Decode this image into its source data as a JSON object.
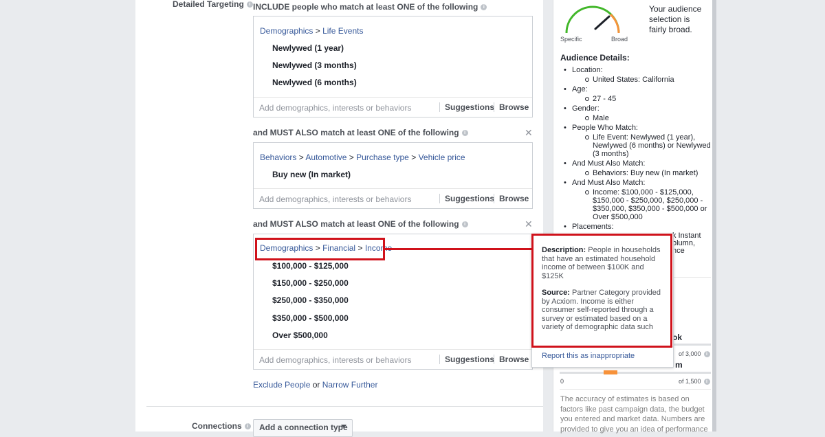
{
  "colors": {
    "accent": "#365899",
    "highlight": "#d0121b",
    "gauge_green": "#42b72a",
    "gauge_orange": "#f7923a",
    "bar_orange": "#f7923a"
  },
  "targeting": {
    "label": "Detailed Targeting",
    "include_text": "INCLUDE people who match at least ONE of the following",
    "boxes": [
      {
        "crumbs": [
          "Demographics",
          "Life Events"
        ],
        "items": [
          "Newlywed (1 year)",
          "Newlywed (3 months)",
          "Newlywed (6 months)"
        ]
      },
      {
        "header": "and MUST ALSO match at least ONE of the following",
        "crumbs": [
          "Behaviors",
          "Automotive",
          "Purchase type",
          "Vehicle price"
        ],
        "items": [
          "Buy new (In market)"
        ]
      },
      {
        "header": "and MUST ALSO match at least ONE of the following",
        "crumbs": [
          "Demographics",
          "Financial",
          "Income"
        ],
        "items": [
          "$100,000 - $125,000",
          "$150,000 - $250,000",
          "$250,000 - $350,000",
          "$350,000 - $500,000",
          "Over $500,000"
        ]
      }
    ],
    "add_placeholder": "Add demographics, interests or behaviors",
    "suggestions": "Suggestions",
    "browse": "Browse",
    "sep": ">",
    "exclude": "Exclude People",
    "or": "or",
    "narrow": "Narrow Further"
  },
  "connections": {
    "label": "Connections",
    "button": "Add a connection type"
  },
  "audience": {
    "gauge_specific": "Specific",
    "gauge_broad": "Broad",
    "summary": "Your audience selection is fairly broad.",
    "details_title": "Audience Details:",
    "details": [
      {
        "label": "Location:",
        "values": [
          "United States: California"
        ]
      },
      {
        "label": "Age:",
        "values": [
          "27 - 45"
        ]
      },
      {
        "label": "Gender:",
        "values": [
          "Male"
        ]
      },
      {
        "label": "People Who Match:",
        "values": [
          "Life Event: Newlywed (1 year), Newlywed (6 months) or Newlywed (3 months)"
        ]
      },
      {
        "label": "And Must Also Match:",
        "values": [
          "Behaviors: Buy new (In market)"
        ]
      },
      {
        "label": "And Must Also Match:",
        "values": [
          "Income: $100,000 - $125,000, $150,000 - $250,000, $250,000 - $350,000, $350,000 - $500,000 or Over $500,000"
        ]
      },
      {
        "label": "Placements:",
        "values": []
      }
    ],
    "placement_frag1": "k Instant",
    "placement_frag2": "olumn,",
    "placement_frag3": "nce",
    "reach_frag": "ok",
    "reach1_of": "of 3,000",
    "reach2_label_frag": "m",
    "reach2_zero": "0",
    "reach2_of": "of 1,500",
    "accuracy": "The accuracy of estimates is based on factors like past campaign data, the budget you entered and market data. Numbers are provided to give you an idea of performance"
  },
  "tooltip": {
    "desc_label": "Description:",
    "desc_text": "People in households that have an estimated household income of between $100K and $125K",
    "source_label": "Source:",
    "source_text": "Partner Category provided by Acxiom. Income is either consumer self-reported through a survey or estimated based on a variety of demographic data such",
    "report": "Report this as inappropriate"
  }
}
